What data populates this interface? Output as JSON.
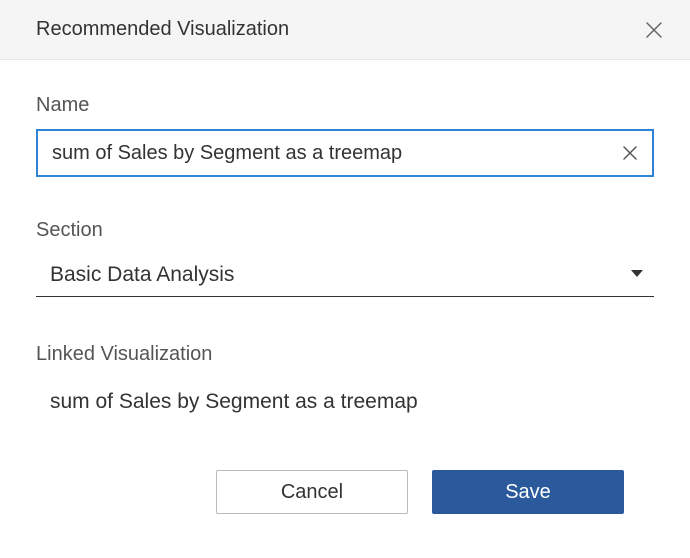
{
  "header": {
    "title": "Recommended Visualization"
  },
  "fields": {
    "name": {
      "label": "Name",
      "value": "sum of Sales by Segment as a treemap"
    },
    "section": {
      "label": "Section",
      "value": "Basic Data Analysis"
    },
    "linked": {
      "label": "Linked Visualization",
      "value": "sum of Sales by Segment as a treemap"
    }
  },
  "buttons": {
    "cancel": "Cancel",
    "save": "Save"
  }
}
